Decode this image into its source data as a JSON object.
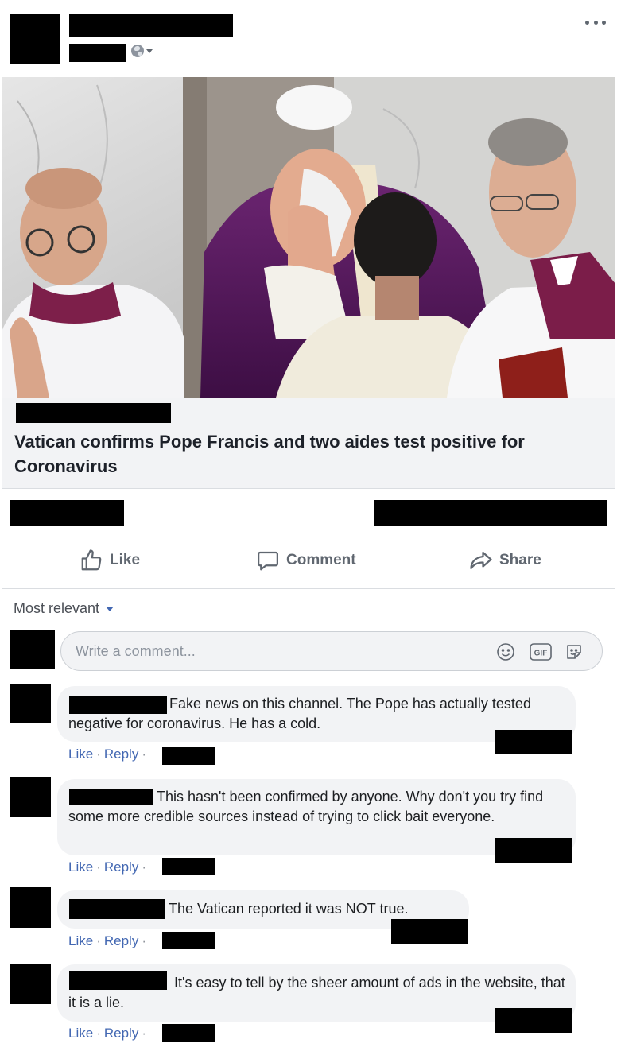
{
  "post": {
    "more_icon": "more-horizontal-icon",
    "privacy_icon": "globe-icon",
    "link_title": "Vatican confirms Pope Francis and two aides test positive for Coronavirus"
  },
  "actions": {
    "like": "Like",
    "comment": "Comment",
    "share": "Share"
  },
  "comments_section": {
    "sort_label": "Most relevant",
    "write_placeholder": "Write a comment...",
    "gif_label": "GIF"
  },
  "comments": [
    {
      "text": "Fake news on this channel. The Pope has actually tested negative for coronavirus. He has a cold.",
      "like": "Like",
      "reply": "Reply"
    },
    {
      "text": "This hasn't been confirmed by anyone. Why don't you try find some more credible sources instead of trying to click bait everyone.",
      "like": "Like",
      "reply": "Reply"
    },
    {
      "text": "The Vatican reported it was NOT true.",
      "like": "Like",
      "reply": "Reply"
    },
    {
      "text": "It's easy to tell by the sheer amount of ads in the website, that it is a lie.",
      "like": "Like",
      "reply": "Reply"
    }
  ],
  "colors": {
    "link_blue": "#4267b2",
    "action_gray": "#606770",
    "bubble_bg": "#f2f3f5"
  }
}
